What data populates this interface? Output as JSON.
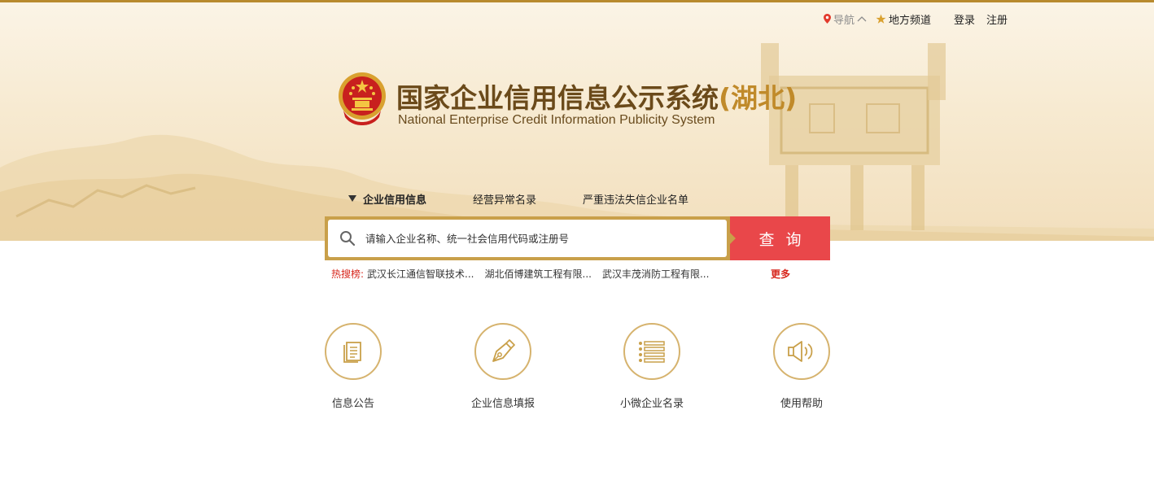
{
  "top_nav": {
    "navigation_label": "导航",
    "local_channel_label": "地方频道",
    "login_label": "登录",
    "register_label": "注册"
  },
  "header": {
    "title_cn": "国家企业信用信息公示系统",
    "title_region": "(湖北)",
    "title_en": "National Enterprise Credit Information Publicity System"
  },
  "search_tabs": [
    {
      "label": "企业信用信息",
      "active": true
    },
    {
      "label": "经营异常名录",
      "active": false
    },
    {
      "label": "严重违法失信企业名单",
      "active": false
    }
  ],
  "search": {
    "placeholder": "请输入企业名称、统一社会信用代码或注册号",
    "button_label": "查询"
  },
  "hot_search": {
    "label": "热搜榜:",
    "items": [
      "武汉长江通信智联技术...",
      "湖北佰博建筑工程有限...",
      "武汉丰茂消防工程有限..."
    ],
    "more_label": "更多"
  },
  "shortcuts": [
    {
      "label": "信息公告",
      "icon": "document-icon"
    },
    {
      "label": "企业信息填报",
      "icon": "pen-nib-icon"
    },
    {
      "label": "小微企业名录",
      "icon": "list-icon"
    },
    {
      "label": "使用帮助",
      "icon": "speaker-icon"
    }
  ],
  "colors": {
    "accent_gold": "#c9a04a",
    "search_button_red": "#e9474a",
    "hot_label_red": "#d7261c",
    "title_brown": "#6b4a1a"
  }
}
